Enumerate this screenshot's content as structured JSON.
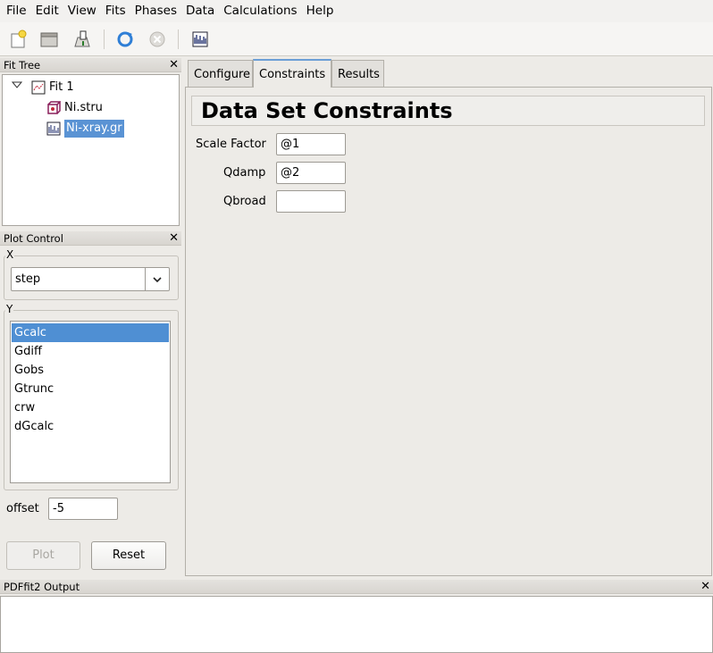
{
  "menu": [
    "File",
    "Edit",
    "View",
    "Fits",
    "Phases",
    "Data",
    "Calculations",
    "Help"
  ],
  "toolbar": [
    "new-project-icon",
    "open-folder-icon",
    "save-icon",
    "refresh-icon",
    "stop-icon",
    "dataset-icon"
  ],
  "fit_tree": {
    "title": "Fit Tree",
    "items": [
      {
        "label": "Fit 1",
        "icon": "fit-icon"
      },
      {
        "label": "Ni.stru",
        "icon": "structure-icon"
      },
      {
        "label": "Ni-xray.gr",
        "icon": "dataset-icon",
        "selected": true
      }
    ]
  },
  "plot_control": {
    "title": "Plot Control",
    "x_label": "X",
    "x_value": "step",
    "y_label": "Y",
    "y_items": [
      "Gcalc",
      "Gdiff",
      "Gobs",
      "Gtrunc",
      "crw",
      "dGcalc"
    ],
    "y_selected": "Gcalc",
    "offset_label": "offset",
    "offset_value": "-5",
    "plot_button": "Plot",
    "reset_button": "Reset"
  },
  "tabs": [
    {
      "label": "Configure",
      "active": false
    },
    {
      "label": "Constraints",
      "active": true
    },
    {
      "label": "Results",
      "active": false
    }
  ],
  "constraints": {
    "header": "Data Set Constraints",
    "fields": [
      {
        "label": "Scale Factor",
        "value": "@1"
      },
      {
        "label": "Qdamp",
        "value": "@2"
      },
      {
        "label": "Qbroad",
        "value": ""
      }
    ]
  },
  "output": {
    "title": "PDFfit2 Output"
  },
  "colors": {
    "selection": "#4f8fd3",
    "background": "#edebe7"
  }
}
